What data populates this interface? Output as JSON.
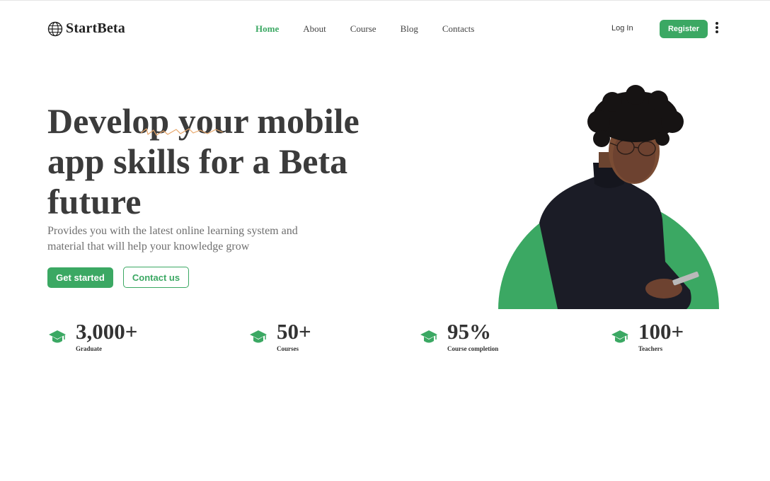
{
  "brand": {
    "name": "StartBeta",
    "icon": "globe-icon"
  },
  "nav": {
    "items": [
      {
        "label": "Home",
        "active": true
      },
      {
        "label": "About",
        "active": false
      },
      {
        "label": "Course",
        "active": false
      },
      {
        "label": "Blog",
        "active": false
      },
      {
        "label": "Contacts",
        "active": false
      }
    ],
    "login_label": "Log In",
    "register_label": "Register",
    "more_icon": "kebab-menu-icon"
  },
  "hero": {
    "headline": "Develop your mobile app skills for a Beta future",
    "subtext": "Provides you with the latest online learning system and material that will help your knowledge grow",
    "primary_cta": "Get started",
    "secondary_cta": "Contact us"
  },
  "stats": [
    {
      "value": "3,000+",
      "label": "Graduate",
      "icon": "graduation-cap-icon"
    },
    {
      "value": "50+",
      "label": "Courses",
      "icon": "graduation-cap-icon"
    },
    {
      "value": "95%",
      "label": "Course completion",
      "icon": "graduation-cap-icon"
    },
    {
      "value": "100+",
      "label": "Teachers",
      "icon": "graduation-cap-icon"
    }
  ],
  "colors": {
    "accent": "#3ba863",
    "heading": "#3b3b3b",
    "body_text": "#6f6f6f",
    "squiggle": "#e8a76b"
  }
}
